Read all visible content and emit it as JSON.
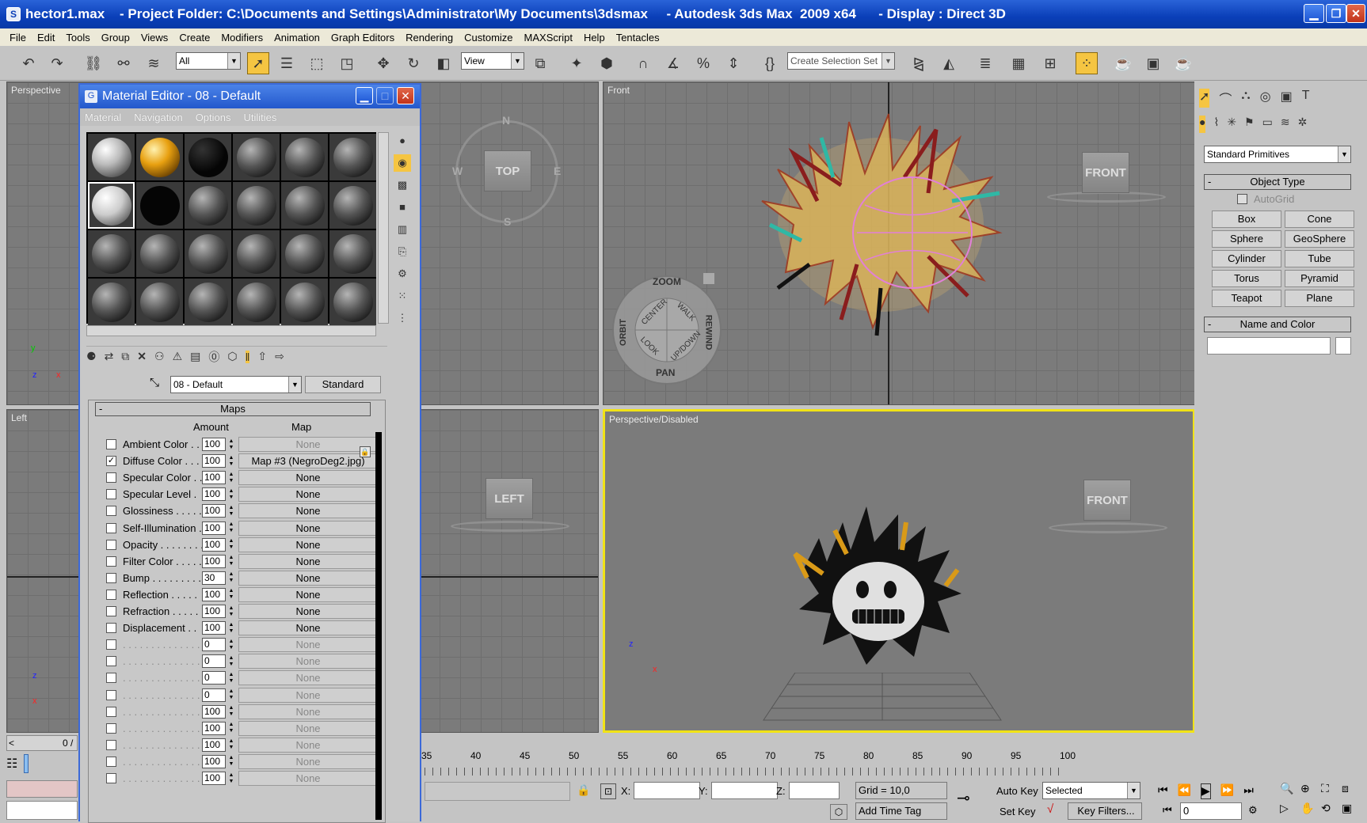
{
  "window": {
    "title": "hector1.max    - Project Folder: C:\\Documents and Settings\\Administrator\\My Documents\\3dsmax     - Autodesk 3ds Max  2009 x64      - Display : Direct 3D",
    "minimize": "▁",
    "restore": "❐",
    "close": "✕"
  },
  "menu": [
    "File",
    "Edit",
    "Tools",
    "Group",
    "Views",
    "Create",
    "Modifiers",
    "Animation",
    "Graph Editors",
    "Rendering",
    "Customize",
    "MAXScript",
    "Help",
    "Tentacles"
  ],
  "toolbar": {
    "filter_value": "All",
    "ref_coord_value": "View",
    "selection_set_placeholder": "Create Selection Set"
  },
  "viewports": {
    "top_left_label": "Perspective",
    "top_right_label": "Front",
    "bottom_left_label": "Left",
    "bottom_right_label": "Perspective/Disabled",
    "cube_top": "TOP",
    "cube_front": "FRONT",
    "cube_front2": "FRONT",
    "cube_left": "LEFT",
    "compass_n": "N",
    "compass_s": "S",
    "compass_w": "W",
    "compass_e": "E",
    "wheel": {
      "zoom": "ZOOM",
      "orbit": "ORBIT",
      "center": "CENTER",
      "walk": "WALK",
      "rewind": "REWIND",
      "look": "LOOK",
      "updown": "UP/DOWN",
      "pan": "PAN"
    },
    "axis_x": "x",
    "axis_y": "y",
    "axis_z": "z"
  },
  "material_editor": {
    "title": "Material Editor - 08 - Default",
    "menu": [
      "Material",
      "Navigation",
      "Options",
      "Utilities"
    ],
    "material_name": "08 - Default",
    "material_type": "Standard",
    "maps_header": "Maps",
    "amount_header": "Amount",
    "map_header": "Map",
    "rows": [
      {
        "label": "Ambient Color . . .",
        "checked": false,
        "amount": "100",
        "map": "None",
        "dim_map": true
      },
      {
        "label": "Diffuse Color . . .",
        "checked": true,
        "amount": "100",
        "map": "Map #3 (NegroDeg2.jpg)",
        "dim_map": false
      },
      {
        "label": "Specular Color . .",
        "checked": false,
        "amount": "100",
        "map": "None",
        "dim_map": false
      },
      {
        "label": "Specular Level  .",
        "checked": false,
        "amount": "100",
        "map": "None",
        "dim_map": false
      },
      {
        "label": "Glossiness . . . . .",
        "checked": false,
        "amount": "100",
        "map": "None",
        "dim_map": false
      },
      {
        "label": "Self-Illumination .",
        "checked": false,
        "amount": "100",
        "map": "None",
        "dim_map": false
      },
      {
        "label": "Opacity . . . . . . . .",
        "checked": false,
        "amount": "100",
        "map": "None",
        "dim_map": false
      },
      {
        "label": "Filter Color  . . . . .",
        "checked": false,
        "amount": "100",
        "map": "None",
        "dim_map": false
      },
      {
        "label": "Bump  . . . . . . . . .",
        "checked": false,
        "amount": "30",
        "map": "None",
        "dim_map": false
      },
      {
        "label": "Reflection  . . . . .",
        "checked": false,
        "amount": "100",
        "map": "None",
        "dim_map": false
      },
      {
        "label": "Refraction  . . . . .",
        "checked": false,
        "amount": "100",
        "map": "None",
        "dim_map": false
      },
      {
        "label": "Displacement  . .",
        "checked": false,
        "amount": "100",
        "map": "None",
        "dim_map": false
      },
      {
        "label": ". . . . . . . . . . . . . .",
        "checked": false,
        "amount": "0",
        "map": "None",
        "dim_map": true
      },
      {
        "label": ". . . . . . . . . . . . . .",
        "checked": false,
        "amount": "0",
        "map": "None",
        "dim_map": true
      },
      {
        "label": ". . . . . . . . . . . . . .",
        "checked": false,
        "amount": "0",
        "map": "None",
        "dim_map": true
      },
      {
        "label": ". . . . . . . . . . . . . .",
        "checked": false,
        "amount": "0",
        "map": "None",
        "dim_map": true
      },
      {
        "label": ". . . . . . . . . . . . . .",
        "checked": false,
        "amount": "100",
        "map": "None",
        "dim_map": true
      },
      {
        "label": ". . . . . . . . . . . . . .",
        "checked": false,
        "amount": "100",
        "map": "None",
        "dim_map": true
      },
      {
        "label": ". . . . . . . . . . . . . .",
        "checked": false,
        "amount": "100",
        "map": "None",
        "dim_map": true
      },
      {
        "label": ". . . . . . . . . . . . . .",
        "checked": false,
        "amount": "100",
        "map": "None",
        "dim_map": true
      },
      {
        "label": ". . . . . . . . . . . . . .",
        "checked": false,
        "amount": "100",
        "map": "None",
        "dim_map": true
      }
    ]
  },
  "command_panel": {
    "category": "Standard Primitives",
    "object_type_header": "Object Type",
    "autogrid": "AutoGrid",
    "buttons": [
      "Box",
      "Cone",
      "Sphere",
      "GeoSphere",
      "Cylinder",
      "Tube",
      "Torus",
      "Pyramid",
      "Teapot",
      "Plane"
    ],
    "name_color_header": "Name and Color"
  },
  "timeline": {
    "slider_label": "0 /",
    "ticks": [
      "35",
      "40",
      "45",
      "50",
      "55",
      "60",
      "65",
      "70",
      "75",
      "80",
      "85",
      "90",
      "95",
      "100"
    ]
  },
  "status": {
    "x_label": "X:",
    "y_label": "Y:",
    "z_label": "Z:",
    "grid": "Grid = 10,0",
    "add_time_tag": "Add Time Tag",
    "auto_key": "Auto Key",
    "set_key": "Set Key",
    "selected": "Selected",
    "key_filters": "Key Filters...",
    "frame": "0"
  }
}
